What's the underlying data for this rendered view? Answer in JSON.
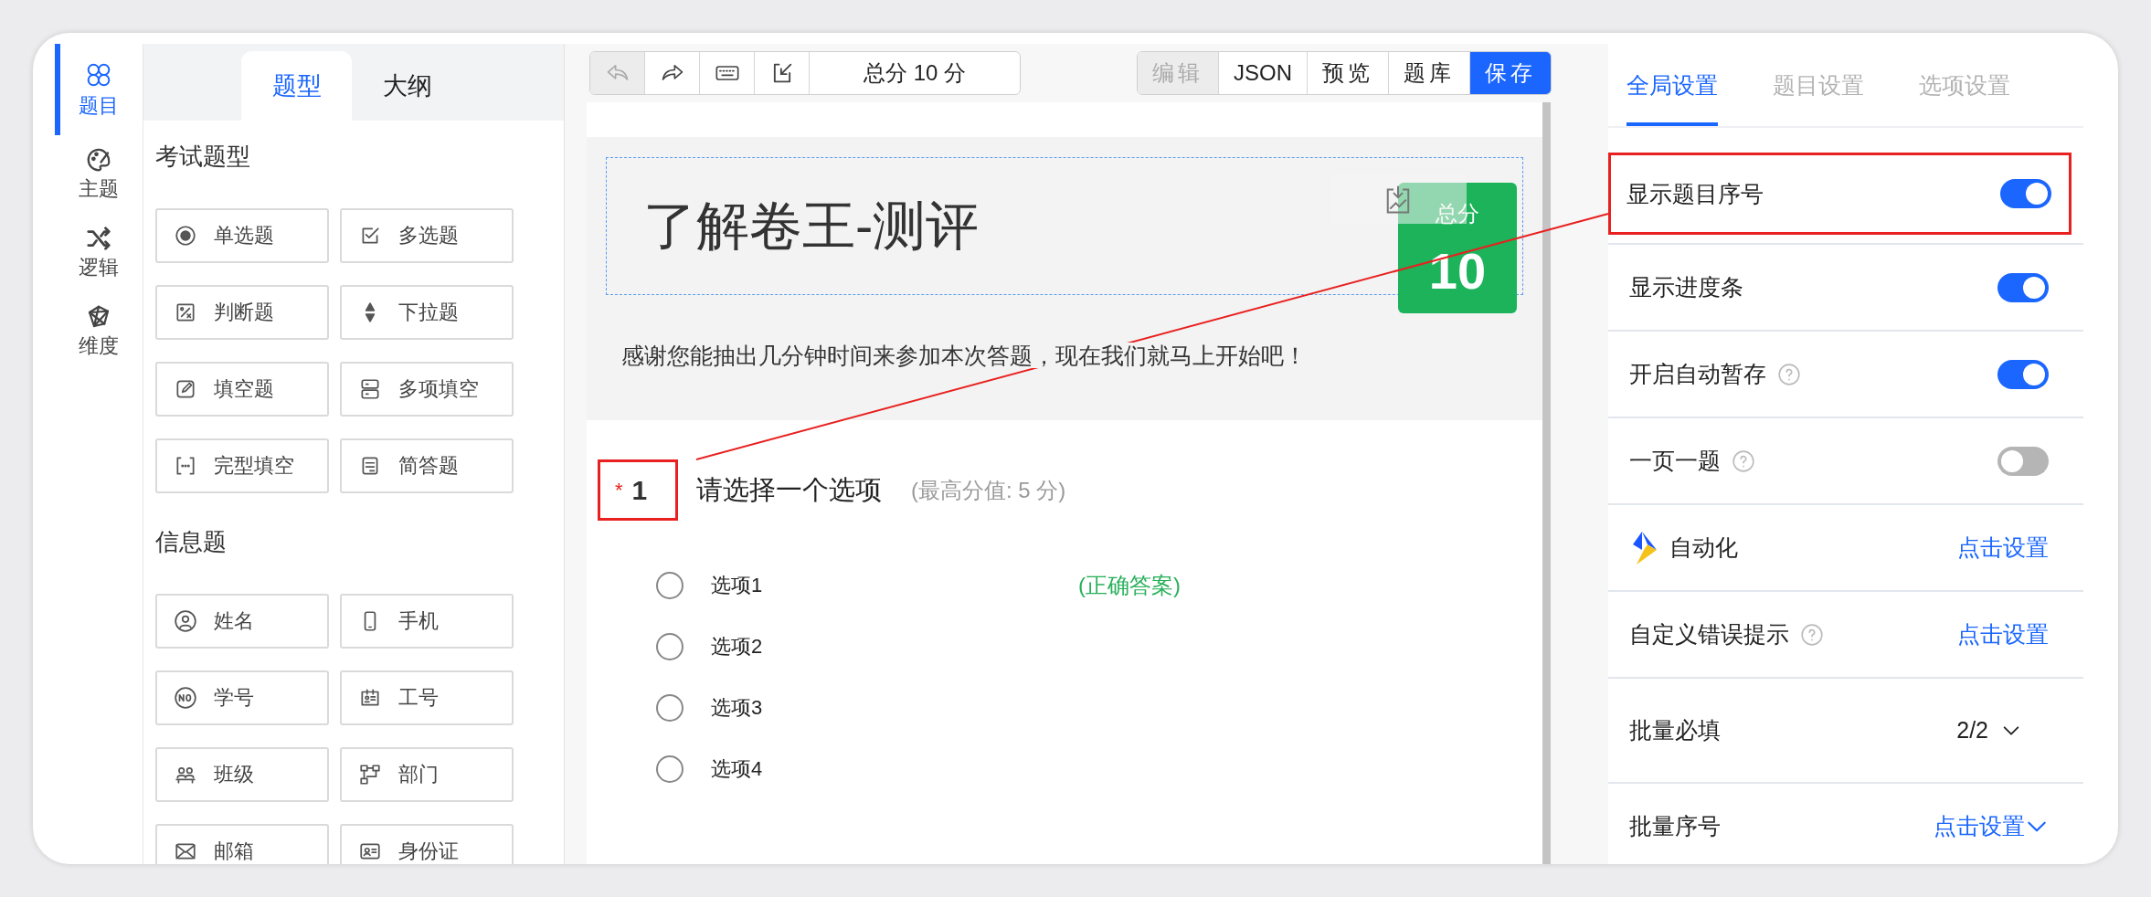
{
  "rail": [
    {
      "kind": "questions",
      "label": "题目",
      "selected": true
    },
    {
      "kind": "theme",
      "label": "主题",
      "selected": false
    },
    {
      "kind": "logic",
      "label": "逻辑",
      "selected": false
    },
    {
      "kind": "dimension",
      "label": "维度",
      "selected": false
    }
  ],
  "panel_tabs": [
    {
      "label": "题型",
      "selected": true
    },
    {
      "label": "大纲",
      "selected": false
    }
  ],
  "sections": [
    {
      "title": "考试题型",
      "items": [
        {
          "kind": "radio",
          "label": "单选题"
        },
        {
          "kind": "checkbox",
          "label": "多选题"
        },
        {
          "kind": "judge",
          "label": "判断题"
        },
        {
          "kind": "dropdown",
          "label": "下拉题"
        },
        {
          "kind": "fill",
          "label": "填空题"
        },
        {
          "kind": "multifill",
          "label": "多项填空"
        },
        {
          "kind": "cloze",
          "label": "完型填空"
        },
        {
          "kind": "essay",
          "label": "简答题"
        }
      ]
    },
    {
      "title": "信息题",
      "items": [
        {
          "kind": "name",
          "label": "姓名"
        },
        {
          "kind": "phone",
          "label": "手机"
        },
        {
          "kind": "studentno",
          "label": "学号"
        },
        {
          "kind": "staffno",
          "label": "工号"
        },
        {
          "kind": "class",
          "label": "班级"
        },
        {
          "kind": "department",
          "label": "部门"
        },
        {
          "kind": "email",
          "label": "邮箱"
        },
        {
          "kind": "idcard",
          "label": "身份证"
        }
      ]
    }
  ],
  "toolbar": {
    "left_buttons": [
      {
        "kind": "undo",
        "disabled": true
      },
      {
        "kind": "redo",
        "disabled": false
      },
      {
        "kind": "keyboard",
        "disabled": false
      },
      {
        "kind": "import",
        "disabled": false
      }
    ],
    "score_label": "总分 10 分",
    "right_buttons": [
      {
        "label": "编辑",
        "kind": "plain",
        "disabled": true
      },
      {
        "label": "JSON",
        "kind": "plain",
        "disabled": false
      },
      {
        "label": "预览",
        "kind": "plain",
        "disabled": false
      },
      {
        "label": "题库",
        "kind": "plain",
        "disabled": false
      },
      {
        "label": "保存",
        "kind": "primary",
        "disabled": false
      }
    ]
  },
  "survey": {
    "title": "了解卷王-测评",
    "score_badge": {
      "label": "总分",
      "value": "10"
    },
    "description": "感谢您能抽出几分钟时间来参加本次答题，现在我们就马上开始吧！"
  },
  "question": {
    "required_mark": "*",
    "number": "1",
    "number_highlighted": true,
    "title": "请选择一个选项",
    "score_note": "(最高分值: 5 分)",
    "options": [
      {
        "label": "选项1",
        "note": "(正确答案)",
        "selected": false
      },
      {
        "label": "选项2",
        "selected": false
      },
      {
        "label": "选项3",
        "selected": false
      },
      {
        "label": "选项4",
        "selected": false
      }
    ]
  },
  "settings_tabs": [
    {
      "label": "全局设置",
      "selected": true
    },
    {
      "label": "题目设置",
      "selected": false
    },
    {
      "label": "选项设置",
      "selected": false
    }
  ],
  "settings": [
    {
      "kind": "toggle",
      "label": "显示题目序号",
      "help": false,
      "on": true,
      "highlighted": true
    },
    {
      "kind": "toggle",
      "label": "显示进度条",
      "help": false,
      "on": true,
      "highlighted": false
    },
    {
      "kind": "toggle",
      "label": "开启自动暂存",
      "help": true,
      "on": true,
      "highlighted": false
    },
    {
      "kind": "toggle",
      "label": "一页一题",
      "help": true,
      "on": false,
      "highlighted": false
    },
    {
      "kind": "link",
      "label": "自动化",
      "help": false,
      "logo": true,
      "link": "点击设置",
      "dropdown": false,
      "highlighted": false
    },
    {
      "kind": "link",
      "label": "自定义错误提示",
      "help": true,
      "logo": false,
      "link": "点击设置",
      "dropdown": false,
      "highlighted": false
    },
    {
      "kind": "select",
      "label": "批量必填",
      "help": false,
      "value": "2/2",
      "highlighted": false
    },
    {
      "kind": "link",
      "label": "批量序号",
      "help": false,
      "logo": false,
      "link": "点击设置",
      "dropdown": true,
      "highlighted": false
    }
  ]
}
